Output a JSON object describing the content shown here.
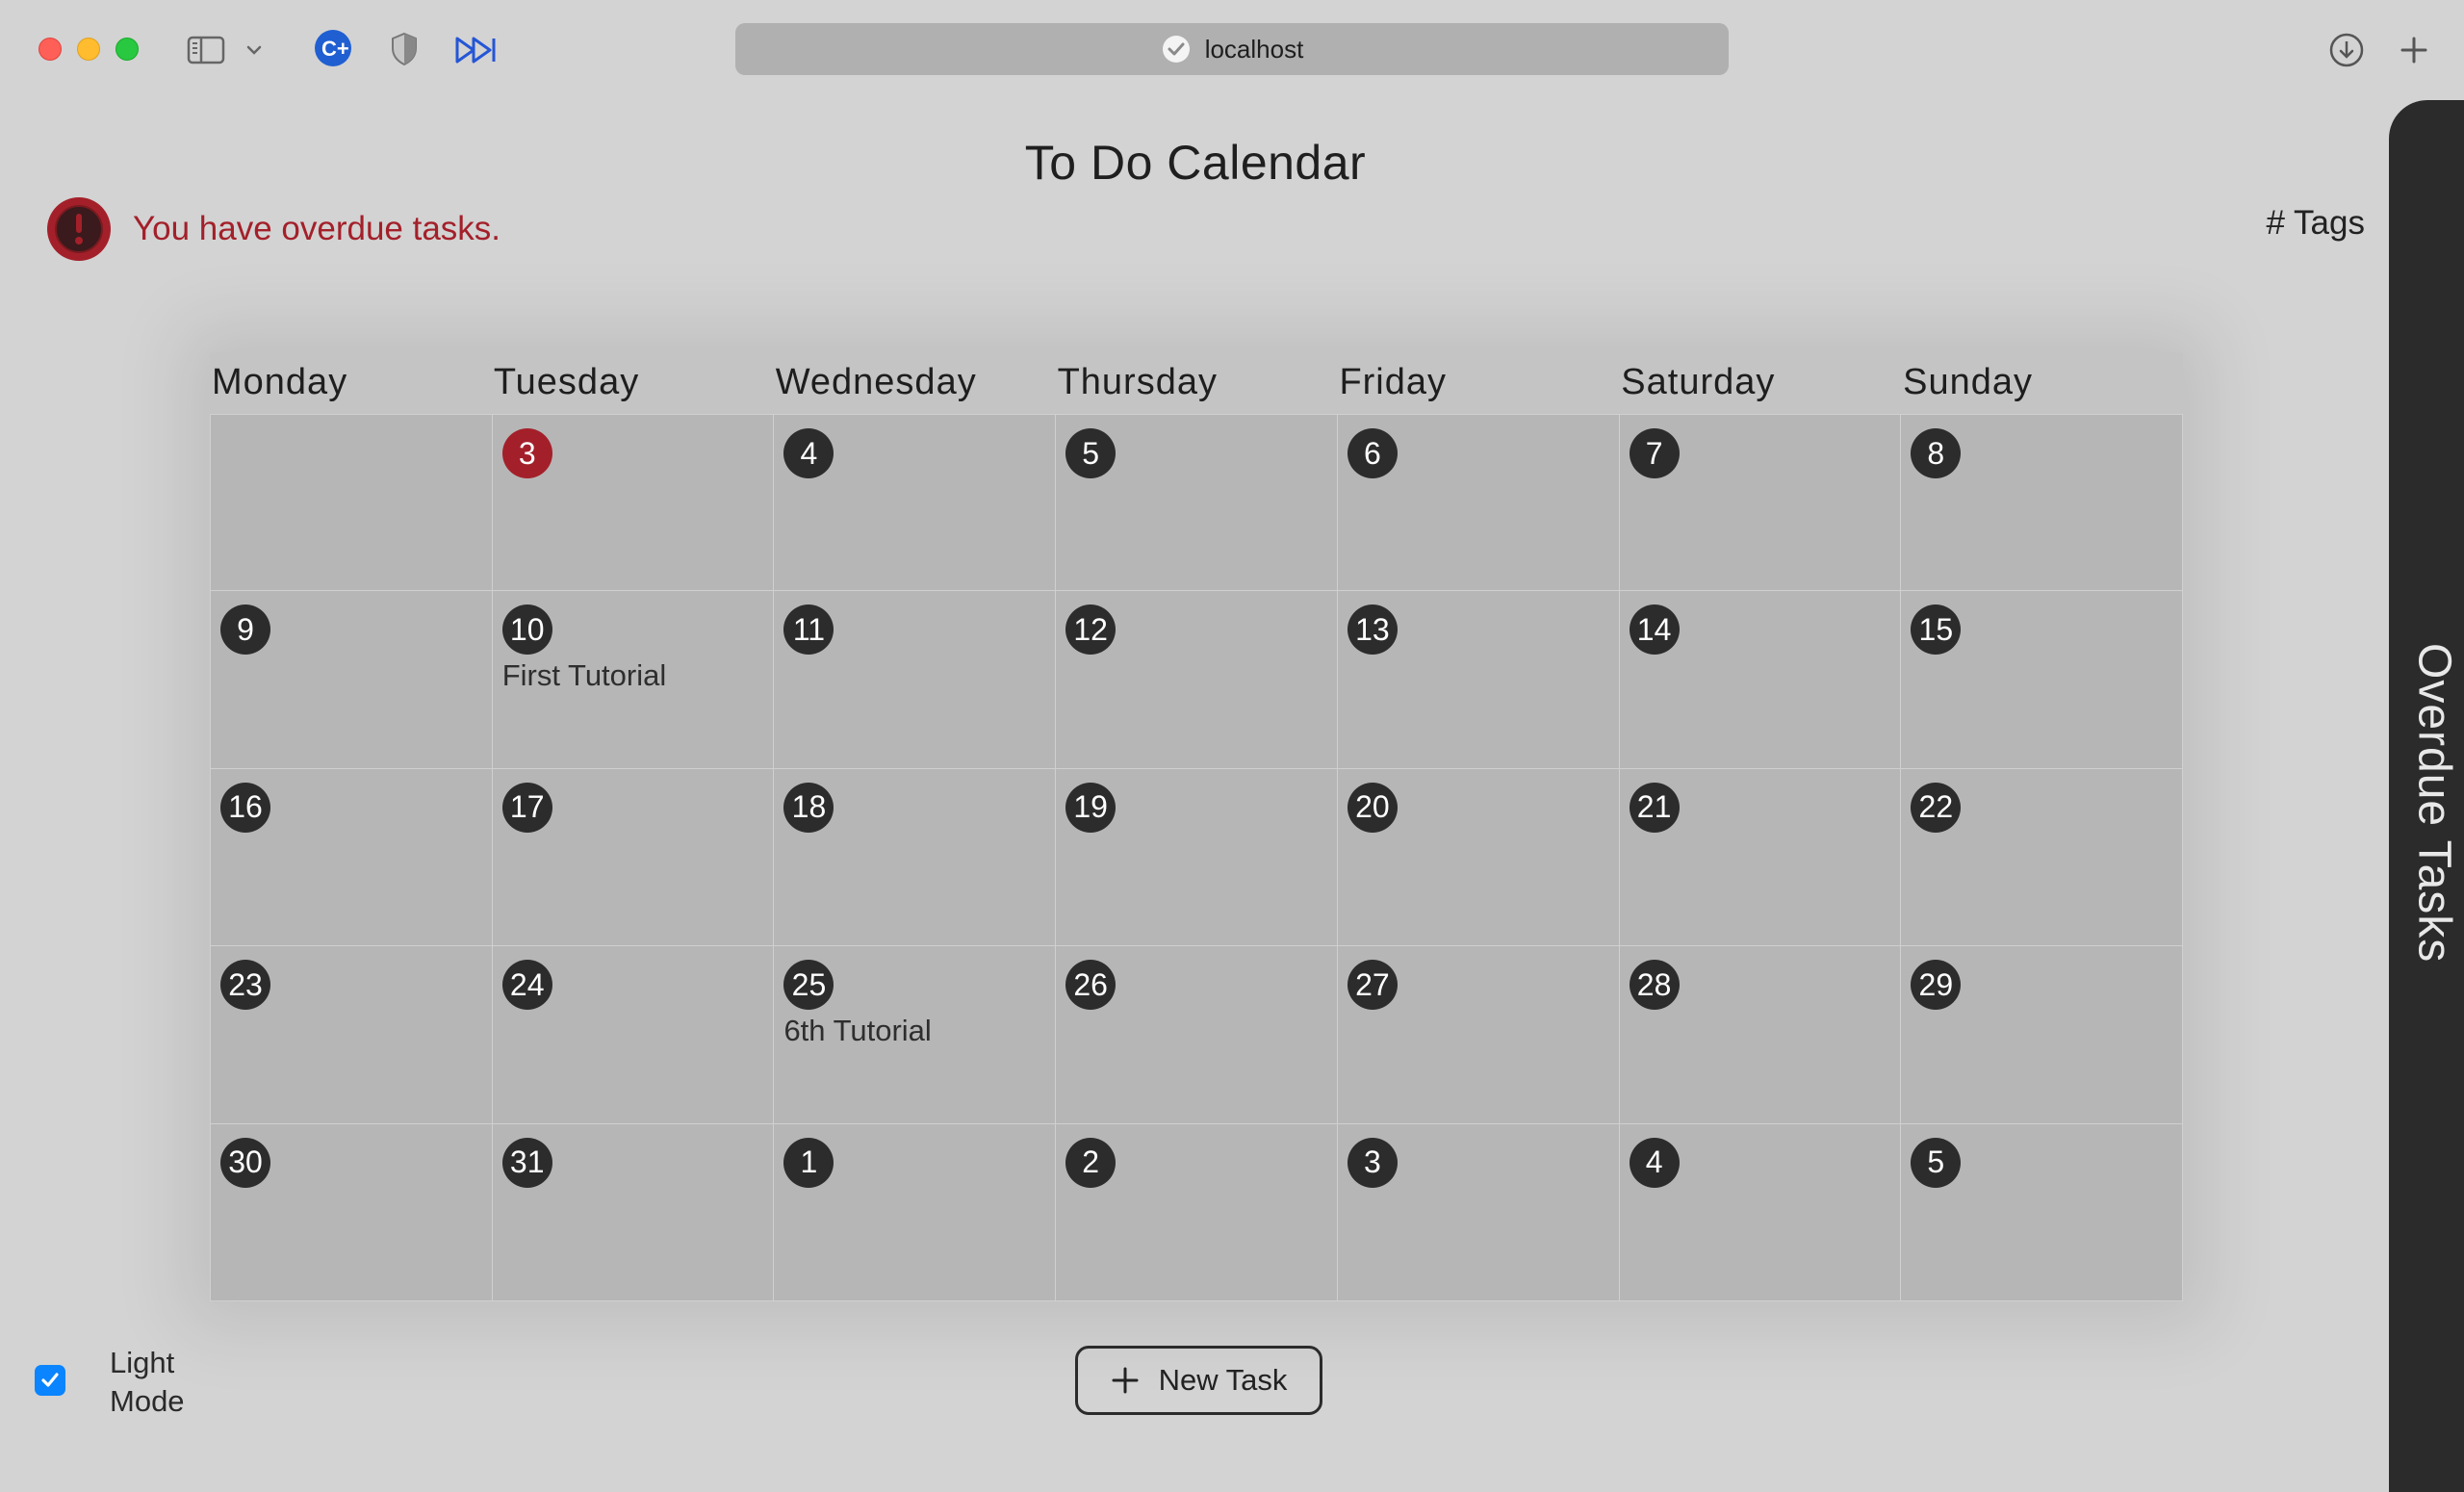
{
  "browser": {
    "url": "localhost",
    "icons": [
      "sidebar-icon",
      "chevron-down-icon",
      "c-plus-extension-icon",
      "shield-icon",
      "fast-forward-icon",
      "download-icon",
      "plus-icon"
    ]
  },
  "page": {
    "title": "To Do Calendar",
    "alert_text": "You have overdue tasks.",
    "tags_label": "# Tags",
    "overdue_tab_label": "Overdue Tasks"
  },
  "colors": {
    "alert_red": "#a3202a",
    "day_badge": "#2c2c2c",
    "checkbox_blue": "#0a84ff"
  },
  "calendar": {
    "weekdays": [
      "Monday",
      "Tuesday",
      "Wednesday",
      "Thursday",
      "Friday",
      "Saturday",
      "Sunday"
    ],
    "weeks": [
      [
        {
          "num": ""
        },
        {
          "num": "3",
          "today": true
        },
        {
          "num": "4"
        },
        {
          "num": "5"
        },
        {
          "num": "6"
        },
        {
          "num": "7"
        },
        {
          "num": "8"
        }
      ],
      [
        {
          "num": "9"
        },
        {
          "num": "10",
          "task": "First Tutorial"
        },
        {
          "num": "11"
        },
        {
          "num": "12"
        },
        {
          "num": "13"
        },
        {
          "num": "14"
        },
        {
          "num": "15"
        }
      ],
      [
        {
          "num": "16"
        },
        {
          "num": "17"
        },
        {
          "num": "18"
        },
        {
          "num": "19"
        },
        {
          "num": "20"
        },
        {
          "num": "21"
        },
        {
          "num": "22"
        }
      ],
      [
        {
          "num": "23"
        },
        {
          "num": "24"
        },
        {
          "num": "25",
          "task": "6th Tutorial"
        },
        {
          "num": "26"
        },
        {
          "num": "27"
        },
        {
          "num": "28"
        },
        {
          "num": "29"
        }
      ],
      [
        {
          "num": "30"
        },
        {
          "num": "31"
        },
        {
          "num": "1"
        },
        {
          "num": "2"
        },
        {
          "num": "3"
        },
        {
          "num": "4"
        },
        {
          "num": "5"
        }
      ]
    ]
  },
  "controls": {
    "light_mode_label": "Light Mode",
    "light_mode_checked": true,
    "new_task_label": "New Task"
  }
}
